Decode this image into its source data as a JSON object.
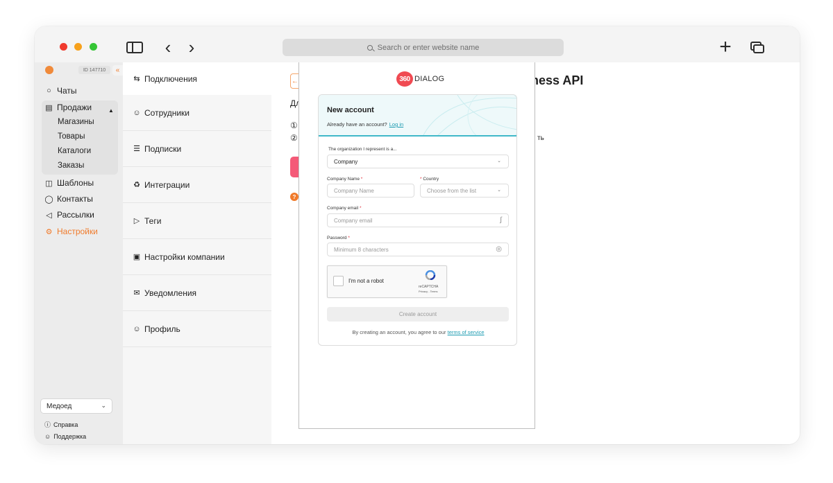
{
  "browser": {
    "address_placeholder": "Search or enter website name",
    "icons": [
      "sidebar-icon",
      "back-icon",
      "forward-icon",
      "search-icon",
      "plus-icon",
      "tabs-icon"
    ]
  },
  "sidebar": {
    "account_id": "ID 147710",
    "collapse_glyph": "«",
    "items": [
      {
        "label": "Чаты",
        "icon": "chat-icon"
      },
      {
        "label": "Продажи",
        "icon": "store-icon"
      },
      {
        "label": "Шаблоны",
        "icon": "template-icon"
      },
      {
        "label": "Контакты",
        "icon": "contacts-icon"
      },
      {
        "label": "Рассылки",
        "icon": "megaphone-icon"
      },
      {
        "label": "Настройки",
        "icon": "gear-icon"
      }
    ],
    "sales_submenu": [
      "Магазины",
      "Товары",
      "Каталоги",
      "Заказы"
    ],
    "bottom_select": "Медоед",
    "help_label": "Справка",
    "support_label": "Поддержка",
    "accent": "#f07a2a"
  },
  "settings": {
    "items": [
      {
        "label": "Подключения",
        "icon": "exchange-icon"
      },
      {
        "label": "Сотрудники",
        "icon": "people-icon"
      },
      {
        "label": "Подписки",
        "icon": "subscription-icon"
      },
      {
        "label": "Интеграции",
        "icon": "puzzle-icon"
      },
      {
        "label": "Теги",
        "icon": "tag-icon"
      },
      {
        "label": "Настройки компании",
        "icon": "briefcase-icon"
      },
      {
        "label": "Уведомления",
        "icon": "mail-icon"
      },
      {
        "label": "Профиль",
        "icon": "profile-icon"
      }
    ]
  },
  "main": {
    "title_fragment": "ness API",
    "frag_1": "Дл",
    "frag_2": "①",
    "frag_3": "②",
    "frag_4": "ть",
    "help_glyph": "?"
  },
  "signup": {
    "brand_number": "360",
    "brand_word": "DIALOG",
    "title": "New account",
    "have_account": "Already have an account?",
    "login_link": "Log in",
    "org_label": "The organization I represent is a...",
    "org_value": "Company",
    "company_name_label": "Company Name",
    "company_name_placeholder": "Company Name",
    "country_label": "Country",
    "country_placeholder": "Choose from the list",
    "email_label": "Company email",
    "email_placeholder": "Company email",
    "password_label": "Password",
    "password_placeholder": "Minimum 8 characters",
    "required_mark": "*",
    "captcha_text": "I'm not a robot",
    "captcha_brand": "reCAPTCHA",
    "captcha_terms": "Privacy - Terms",
    "create_button": "Create account",
    "tos_text": "By creating an account, you agree to our",
    "tos_link": "terms of service",
    "accent": "#3fb8c8"
  }
}
